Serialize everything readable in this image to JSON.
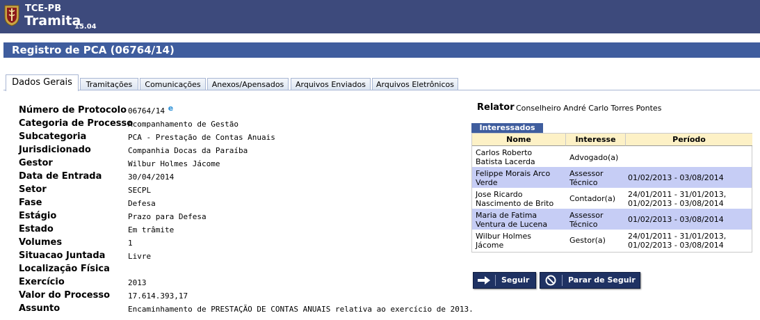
{
  "header": {
    "org": "TCE-PB",
    "app": "Tramita",
    "version": "15.04"
  },
  "page_title": "Registro de PCA (06764/14)",
  "tabs": [
    "Dados Gerais",
    "Tramitações",
    "Comunicações",
    "Anexos/Apensados",
    "Arquivos Enviados",
    "Arquivos Eletrônicos"
  ],
  "fields": [
    {
      "label": "Número de Protocolo",
      "value": "06764/14"
    },
    {
      "label": "Categoria de Processo",
      "value": "Acompanhamento de Gestão"
    },
    {
      "label": "Subcategoria",
      "value": "PCA - Prestação de Contas Anuais"
    },
    {
      "label": "Jurisdicionado",
      "value": "Companhia Docas da Paraíba"
    },
    {
      "label": "Gestor",
      "value": "Wilbur Holmes Jácome"
    },
    {
      "label": "Data de Entrada",
      "value": "30/04/2014"
    },
    {
      "label": "Setor",
      "value": "SECPL"
    },
    {
      "label": "Fase",
      "value": "Defesa"
    },
    {
      "label": "Estágio",
      "value": "Prazo para Defesa"
    },
    {
      "label": "Estado",
      "value": "Em trâmite"
    },
    {
      "label": "Volumes",
      "value": "1"
    },
    {
      "label": "Situacao Juntada",
      "value": "Livre"
    },
    {
      "label": "Localização Física",
      "value": ""
    },
    {
      "label": "Exercício",
      "value": "2013"
    },
    {
      "label": "Valor do Processo",
      "value": "17.614.393,17"
    },
    {
      "label": "Assunto",
      "value": "Encaminhamento de PRESTAÇÃO DE CONTAS ANUAIS relativa ao exercício de 2013."
    }
  ],
  "relator": {
    "label": "Relator",
    "value": "Conselheiro André Carlo Torres Pontes"
  },
  "interessados": {
    "caption": "Interessados",
    "columns": [
      "Nome",
      "Interesse",
      "Período"
    ],
    "rows": [
      {
        "nome": [
          "Carlos Roberto",
          "Batista Lacerda"
        ],
        "interesse": [
          "Advogado(a)"
        ],
        "periodo": [
          ""
        ],
        "highlight": false
      },
      {
        "nome": [
          "Felippe Morais Arco",
          "Verde"
        ],
        "interesse": [
          "Assessor",
          "Técnico"
        ],
        "periodo": [
          "01/02/2013 - 03/08/2014"
        ],
        "highlight": true
      },
      {
        "nome": [
          "Jose Ricardo",
          "Nascimento de Brito"
        ],
        "interesse": [
          "Contador(a)"
        ],
        "periodo": [
          "24/01/2011 - 31/01/2013,",
          "01/02/2013 - 03/08/2014"
        ],
        "highlight": false
      },
      {
        "nome": [
          "Maria de Fatima",
          "Ventura de Lucena"
        ],
        "interesse": [
          "Assessor",
          "Técnico"
        ],
        "periodo": [
          "01/02/2013 - 03/08/2014"
        ],
        "highlight": true
      },
      {
        "nome": [
          "Wilbur Holmes",
          "Jácome"
        ],
        "interesse": [
          "Gestor(a)"
        ],
        "periodo": [
          "24/01/2011 - 31/01/2013,",
          "01/02/2013 - 03/08/2014"
        ],
        "highlight": false
      }
    ]
  },
  "buttons": {
    "follow": "Seguir",
    "unfollow": "Parar de Seguir"
  },
  "colors": {
    "header_bg": "#3d4a7c",
    "title_bg": "#3f5d9e",
    "row_highlight": "#c6cdf5",
    "grid_header": "#fdf1c6",
    "button_bg": "#1f3263"
  },
  "icons": {
    "logo": "tce-pb-crest",
    "protocol": "e-process-icon",
    "follow": "arrow-right-icon",
    "unfollow": "no-entry-icon"
  }
}
